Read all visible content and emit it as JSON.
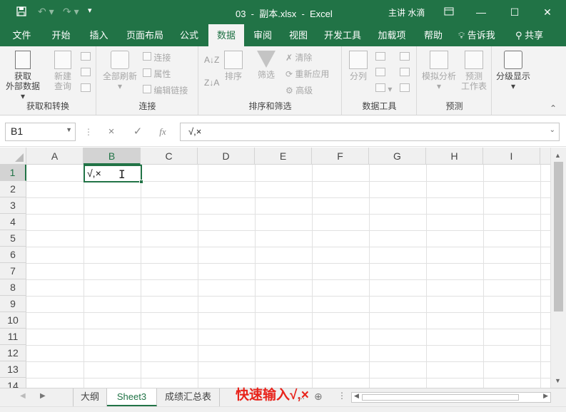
{
  "title_bar": {
    "document_title": "03  -  副本.xlsx  -  Excel",
    "user": "主讲 水滴",
    "quick_access": [
      "save-icon",
      "undo-icon",
      "redo-icon",
      "customize-icon"
    ],
    "window_buttons": [
      "ribbon-display-icon",
      "minimize-icon",
      "maximize-icon",
      "close-icon"
    ]
  },
  "menu_tabs": [
    "文件",
    "开始",
    "插入",
    "页面布局",
    "公式",
    "数据",
    "审阅",
    "视图",
    "开发工具",
    "加载项",
    "帮助"
  ],
  "active_tab": "数据",
  "tell_me": "告诉我",
  "share": "共享",
  "ribbon": {
    "groups": [
      {
        "label": "获取和转换",
        "buttons": [
          {
            "label": "获取",
            "label2": "外部数据"
          },
          {
            "label": "新建",
            "label2": "查询"
          }
        ]
      },
      {
        "label": "连接",
        "buttons": [
          {
            "label": "全部刷新"
          }
        ],
        "small": [
          "连接",
          "属性",
          "编辑链接"
        ]
      },
      {
        "label": "排序和筛选",
        "buttons": [
          {
            "label": "排序"
          },
          {
            "label": "筛选"
          }
        ],
        "small": [
          "清除",
          "重新应用",
          "高级"
        ]
      },
      {
        "label": "数据工具",
        "buttons": [
          {
            "label": "分列"
          }
        ]
      },
      {
        "label": "预测",
        "buttons": [
          {
            "label": "模拟分析"
          },
          {
            "label": "预测",
            "label2": "工作表"
          }
        ]
      },
      {
        "label": "",
        "buttons": [
          {
            "label": "分级显示"
          }
        ]
      }
    ]
  },
  "formula_bar": {
    "name_box": "B1",
    "fx_label": "fx",
    "cancel_icon": "×",
    "enter_icon": "✓",
    "content": "√,×"
  },
  "columns": [
    "A",
    "B",
    "C",
    "D",
    "E",
    "F",
    "G",
    "H",
    "I"
  ],
  "rows": [
    "1",
    "2",
    "3",
    "4",
    "5",
    "6",
    "7",
    "8",
    "9",
    "10",
    "11",
    "12",
    "13",
    "14"
  ],
  "active_cell": {
    "ref": "B1",
    "value": "√,×"
  },
  "sheets": [
    "大纲",
    "Sheet3",
    "成绩汇总表"
  ],
  "active_sheet": "Sheet3",
  "sheet_overflow": "...",
  "caption": "快速输入√,×",
  "colors": {
    "accent": "#217346",
    "caption": "#e8231b"
  }
}
